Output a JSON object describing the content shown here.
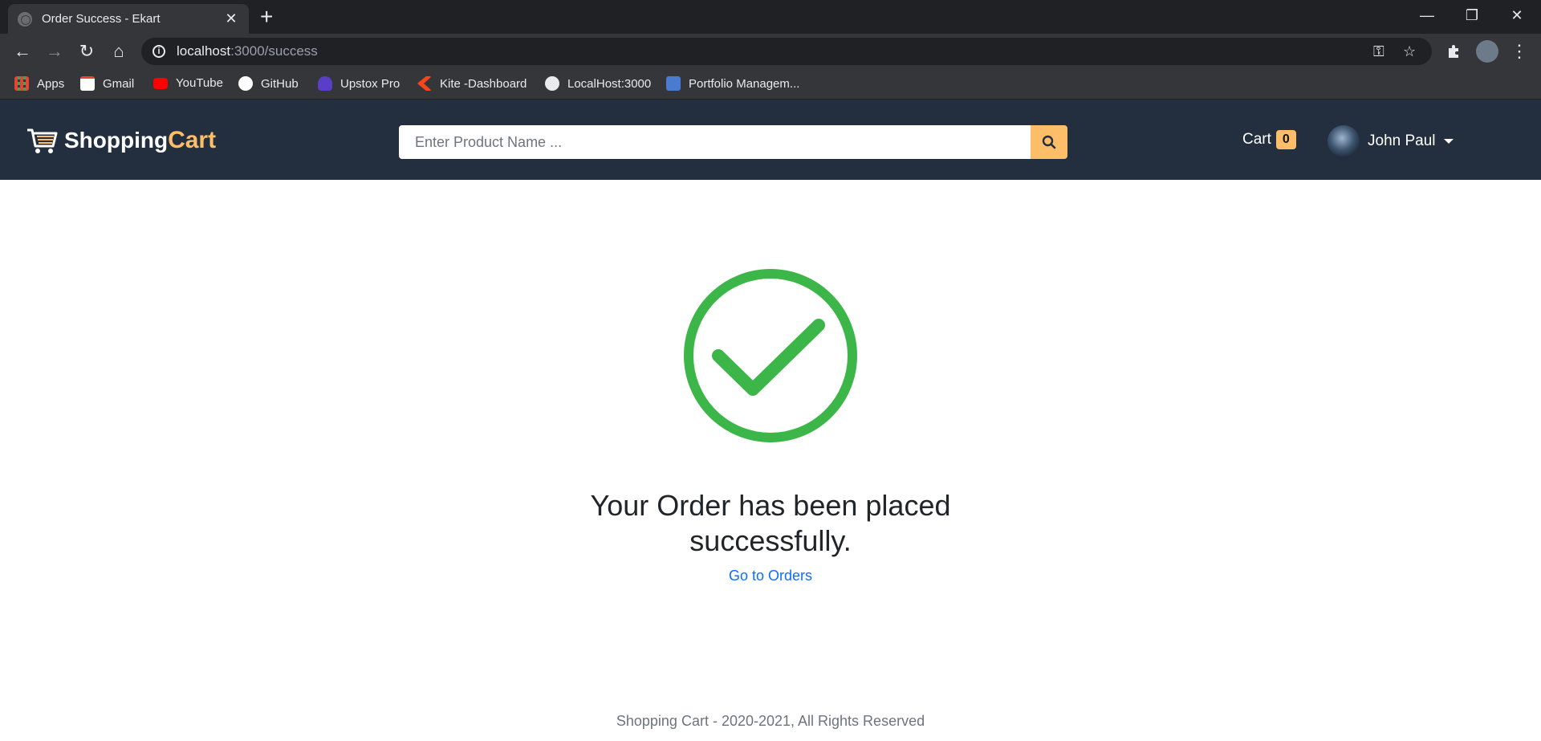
{
  "browser": {
    "tab_title": "Order Success - Ekart",
    "new_tab": "+",
    "url_host": "localhost",
    "url_path": ":3000/success",
    "bookmarks": [
      {
        "label": "Apps",
        "icon": "apps-grid-icon",
        "color": "#4285f4"
      },
      {
        "label": "Gmail",
        "icon": "gmail-icon",
        "color": "#ea4335"
      },
      {
        "label": "YouTube",
        "icon": "youtube-icon",
        "color": "#ff0000"
      },
      {
        "label": "GitHub",
        "icon": "github-icon",
        "color": "#ffffff"
      },
      {
        "label": "Upstox Pro",
        "icon": "upstox-icon",
        "color": "#5a3ec8"
      },
      {
        "label": "Kite -Dashboard",
        "icon": "kite-icon",
        "color": "#f6461a"
      },
      {
        "label": "LocalHost:3000",
        "icon": "globe-icon",
        "color": "#e8eaed"
      },
      {
        "label": "Portfolio Managem...",
        "icon": "portfolio-icon",
        "color": "#4a7bd0"
      }
    ]
  },
  "header": {
    "logo_part1": "Shopping",
    "logo_part2": "Cart",
    "search_placeholder": "Enter Product Name ...",
    "cart_label": "Cart",
    "cart_count": "0",
    "user_name": "John Paul",
    "bg_color": "#232f3e",
    "accent_color": "#febd69"
  },
  "main": {
    "success_message": "Your Order has been placed successfully.",
    "orders_link": "Go to Orders",
    "success_color": "#3cb648"
  },
  "footer": {
    "text": "Shopping Cart - 2020-2021, All Rights Reserved"
  }
}
